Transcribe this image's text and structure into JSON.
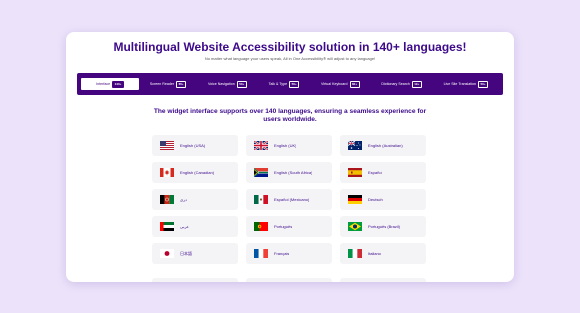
{
  "header": {
    "title": "Multilingual Website Accessibility solution in 140+ languages!",
    "subtitle": "No matter what language your users speak, All in One Accessibility® will adjust to any language!"
  },
  "nav": {
    "tabs": [
      {
        "label": "Interface",
        "badge": "140+",
        "active": true
      },
      {
        "label": "Screen Reader",
        "badge": "65+",
        "active": false
      },
      {
        "label": "Voice Navigation",
        "badge": "50+",
        "active": false
      },
      {
        "label": "Talk & Type",
        "badge": "50+",
        "active": false
      },
      {
        "label": "Virtual Keyboard",
        "badge": "80+",
        "active": false
      },
      {
        "label": "Dictionary Search",
        "badge": "19+",
        "active": false
      },
      {
        "label": "Live Site Translation",
        "badge": "50+",
        "active": false
      }
    ]
  },
  "main": {
    "heading": "The widget interface supports over 140 languages, ensuring a seamless experience for users worldwide.",
    "languages": [
      {
        "label": "English (USA)",
        "flag": "us-flag-icon"
      },
      {
        "label": "English (UK)",
        "flag": "uk-flag-icon"
      },
      {
        "label": "English (Australian)",
        "flag": "australia-flag-icon"
      },
      {
        "label": "English (Canadian)",
        "flag": "canada-flag-icon"
      },
      {
        "label": "English (South Africa)",
        "flag": "south-africa-flag-icon"
      },
      {
        "label": "Español",
        "flag": "spain-flag-icon"
      },
      {
        "label": "دری",
        "flag": "afghanistan-flag-icon"
      },
      {
        "label": "Español (Mexicano)",
        "flag": "mexico-flag-icon"
      },
      {
        "label": "Deutsch",
        "flag": "germany-flag-icon"
      },
      {
        "label": "عربى",
        "flag": "uae-flag-icon"
      },
      {
        "label": "Português",
        "flag": "portugal-flag-icon"
      },
      {
        "label": "Português (Brazil)",
        "flag": "brazil-flag-icon"
      },
      {
        "label": "日本語",
        "flag": "japan-flag-icon"
      },
      {
        "label": "Français",
        "flag": "france-flag-icon"
      },
      {
        "label": "Italiano",
        "flag": "italy-flag-icon"
      }
    ]
  },
  "colors": {
    "background": "#ece3fb",
    "brand": "#44057f",
    "tile": "#f4f4f7"
  }
}
